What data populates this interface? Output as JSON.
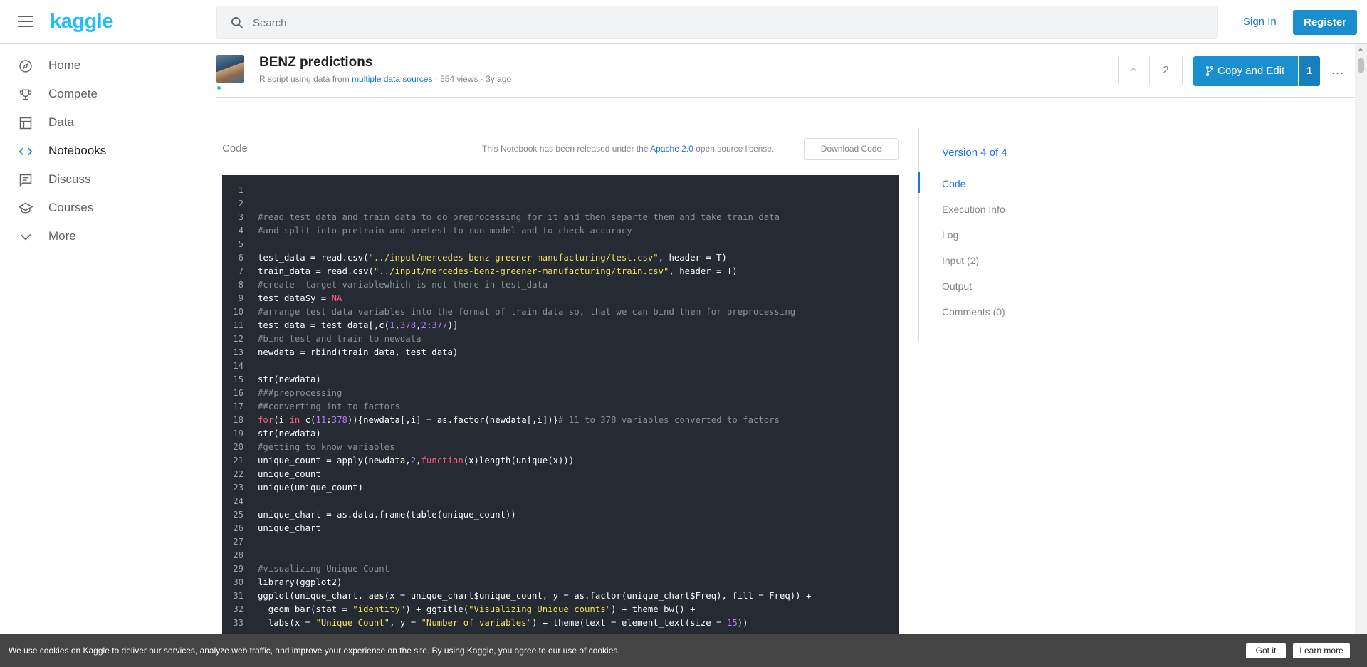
{
  "topbar": {
    "logo": "kaggle",
    "search_placeholder": "Search",
    "signin_label": "Sign In",
    "register_label": "Register"
  },
  "sidebar": {
    "items": [
      {
        "label": "Home",
        "icon": "compass-icon"
      },
      {
        "label": "Compete",
        "icon": "trophy-icon"
      },
      {
        "label": "Data",
        "icon": "table-icon"
      },
      {
        "label": "Notebooks",
        "icon": "code-icon"
      },
      {
        "label": "Discuss",
        "icon": "comment-icon"
      },
      {
        "label": "Courses",
        "icon": "school-icon"
      },
      {
        "label": "More",
        "icon": "chevron-down-icon"
      }
    ],
    "active": "Notebooks"
  },
  "header": {
    "title": "BENZ predictions",
    "meta_prefix": "R script using data from",
    "meta_link": "multiple data sources",
    "meta_suffix": "· 554 views · 3y ago",
    "vote_count": "2",
    "copy_edit_label": "Copy and Edit",
    "copy_count": "1",
    "more_label": "..."
  },
  "code_section": {
    "heading": "Code",
    "license_prefix": "This Notebook has been released under the",
    "license_link": "Apache 2.0",
    "license_suffix": "open source license.",
    "download_label": "Download Code"
  },
  "code_lines": [
    {
      "n": "1",
      "text": ""
    },
    {
      "n": "2",
      "text": ""
    },
    {
      "n": "3",
      "text": "#read test data and train data to do preprocessing for it and then separte them and take train data"
    },
    {
      "n": "4",
      "text": "#and split into pretrain and pretest to run model and to check accuracy"
    },
    {
      "n": "5",
      "text": ""
    },
    {
      "n": "6",
      "text": "test_data = read.csv(\"../input/mercedes-benz-greener-manufacturing/test.csv\", header = T)"
    },
    {
      "n": "7",
      "text": "train_data = read.csv(\"../input/mercedes-benz-greener-manufacturing/train.csv\", header = T)"
    },
    {
      "n": "8",
      "text": "#create  target variablewhich is not there in test_data"
    },
    {
      "n": "9",
      "text": "test_data$y = NA"
    },
    {
      "n": "10",
      "text": "#arrange test data variables into the format of train data so, that we can bind them for preprocessing"
    },
    {
      "n": "11",
      "text": "test_data = test_data[,c(1,378,2:377)]"
    },
    {
      "n": "12",
      "text": "#bind test and train to newdata"
    },
    {
      "n": "13",
      "text": "newdata = rbind(train_data, test_data)"
    },
    {
      "n": "14",
      "text": ""
    },
    {
      "n": "15",
      "text": "str(newdata)"
    },
    {
      "n": "16",
      "text": "###preprocessing"
    },
    {
      "n": "17",
      "text": "##converting int to factors"
    },
    {
      "n": "18",
      "text": "for(i in c(11:378)){newdata[,i] = as.factor(newdata[,i])}# 11 to 378 variables converted to factors"
    },
    {
      "n": "19",
      "text": "str(newdata)"
    },
    {
      "n": "20",
      "text": "#getting to know variables"
    },
    {
      "n": "21",
      "text": "unique_count = apply(newdata,2,function(x)length(unique(x)))"
    },
    {
      "n": "22",
      "text": "unique_count"
    },
    {
      "n": "23",
      "text": "unique(unique_count)"
    },
    {
      "n": "24",
      "text": ""
    },
    {
      "n": "25",
      "text": "unique_chart = as.data.frame(table(unique_count))"
    },
    {
      "n": "26",
      "text": "unique_chart"
    },
    {
      "n": "27",
      "text": ""
    },
    {
      "n": "28",
      "text": ""
    },
    {
      "n": "29",
      "text": "#visualizing Unique Count"
    },
    {
      "n": "30",
      "text": "library(ggplot2)"
    },
    {
      "n": "31",
      "text": "ggplot(unique_chart, aes(x = unique_chart$unique_count, y = as.factor(unique_chart$Freq), fill = Freq)) +"
    },
    {
      "n": "32",
      "text": "  geom_bar(stat = \"identity\") + ggtitle(\"Visualizing Unique counts\") + theme_bw() +"
    },
    {
      "n": "33",
      "text": "  labs(x = \"Unique Count\", y = \"Number of variables\") + theme(text = element_text(size = 15))"
    }
  ],
  "right_nav": {
    "version": "Version 4 of 4",
    "items": [
      "Code",
      "Execution Info",
      "Log",
      "Input (2)",
      "Output",
      "Comments (0)"
    ],
    "active": "Code"
  },
  "cookie": {
    "text": "We use cookies on Kaggle to deliver our services, analyze web traffic, and improve your experience on the site. By using Kaggle, you agree to our use of cookies.",
    "got_it": "Got it",
    "learn_more": "Learn more"
  },
  "colors": {
    "brand": "#20beff",
    "accent_blue": "#1a8fd0",
    "code_bg": "#252a33"
  }
}
